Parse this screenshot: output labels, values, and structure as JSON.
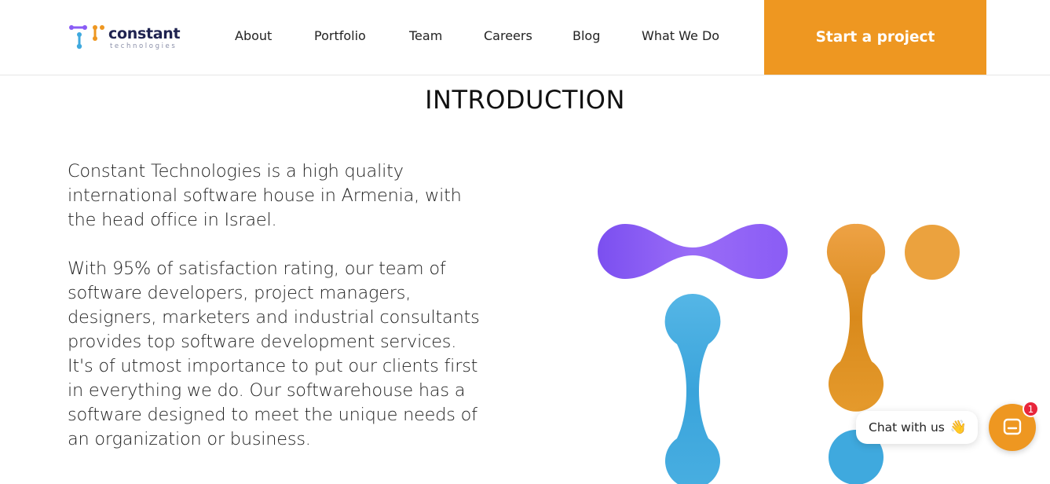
{
  "brand": {
    "name": "constant",
    "tagline": "technologies"
  },
  "nav": {
    "items": [
      {
        "label": "About"
      },
      {
        "label": "Portfolio"
      },
      {
        "label": "Team"
      },
      {
        "label": "Careers"
      },
      {
        "label": "Blog"
      },
      {
        "label": "What We Do"
      }
    ],
    "cta_label": "Start a project"
  },
  "main": {
    "title": "INTRODUCTION",
    "paragraphs": [
      "Constant Technologies is a high quality international software house in Armenia, with the head office in Israel.",
      "With 95% of satisfaction rating, our team of software developers, project managers, designers, marketers and industrial consultants provides top software development services.",
      "It's of utmost importance to put our clients first in everything we do. Our softwarehouse has a software designed to meet the unique needs of an organization or business."
    ]
  },
  "chat": {
    "bubble_text": "Chat with us",
    "wave_emoji": "👋",
    "badge_count": "1"
  },
  "colors": {
    "accent_orange": "#ee9721",
    "brand_purple": "#8a5cf5",
    "brand_blue": "#3fa9de",
    "badge_red": "#e8263b",
    "logo_navy": "#1f2350"
  }
}
